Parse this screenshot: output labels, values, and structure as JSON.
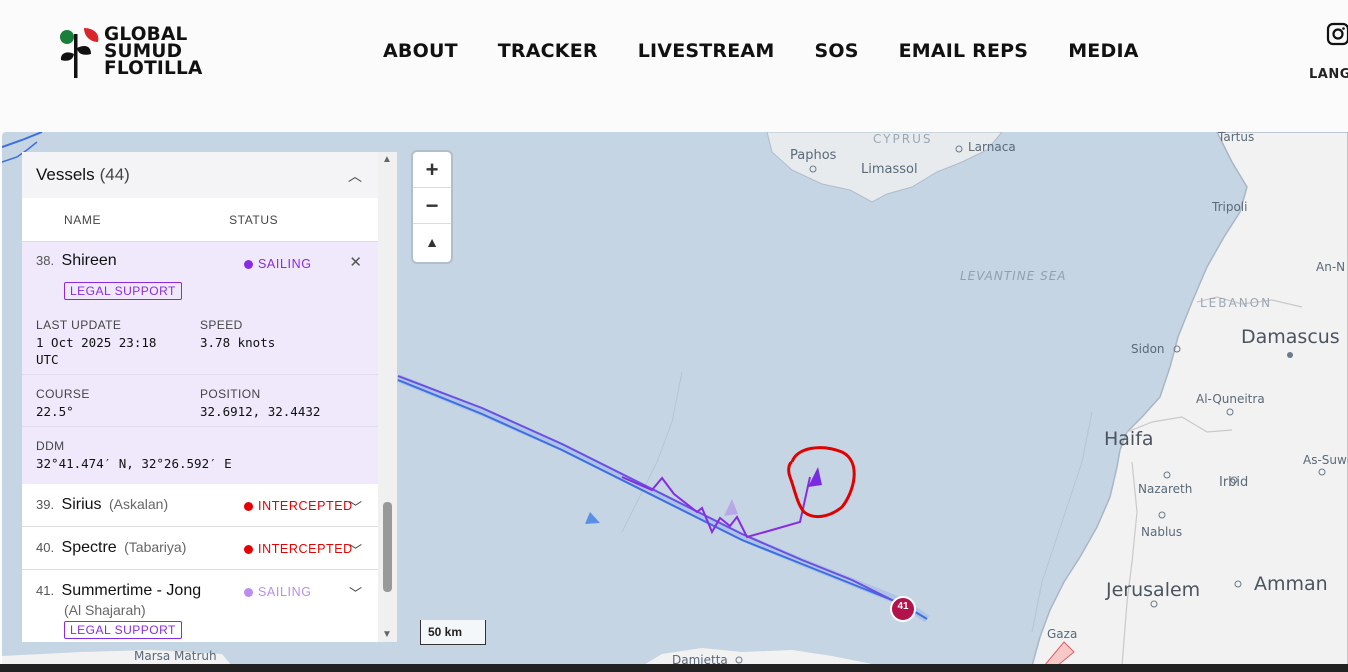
{
  "header": {
    "logo": [
      "GLOBAL",
      "SUMUD",
      "FLOTILLA"
    ],
    "nav": [
      "ABOUT",
      "TRACKER",
      "LIVESTREAM",
      "SOS",
      "EMAIL REPS",
      "MEDIA"
    ],
    "lang": "LANG"
  },
  "map": {
    "places": {
      "cyprus": "CYPRUS",
      "paphos": "Paphos",
      "limassol": "Limassol",
      "larnaca": "Larnaca",
      "tartus": "Tartus",
      "tripoli": "Tripoli",
      "an_n": "An-N",
      "lebanon": "LEBANON",
      "damascus": "Damascus",
      "sidon": "Sidon",
      "levantine": "LEVANTINE SEA",
      "al_quneitra": "Al-Quneitra",
      "haifa": "Haifa",
      "as_sweida": "As-Suweid",
      "nazareth": "Nazareth",
      "irbid": "Irbid",
      "nablus": "Nablus",
      "jerusalem": "Jerusalem",
      "amman": "Amman",
      "gaza": "Gaza",
      "damietta": "Damietta",
      "marsa": "Marsa Matruh"
    },
    "marker_label": "41",
    "scale_label": "50 km",
    "zoom": {
      "in": "+",
      "out": "−",
      "compass": "▲"
    }
  },
  "panel": {
    "title": "Vessels",
    "count": "(44)",
    "col_name": "NAME",
    "col_status": "STATUS",
    "selected": {
      "num": "38.",
      "name": "Shireen",
      "status": "SAILING",
      "badge": "LEGAL SUPPORT",
      "last_update_label": "LAST UPDATE",
      "last_update": "1 Oct 2025 23:18 UTC",
      "speed_label": "SPEED",
      "speed": "3.78 knots",
      "course_label": "COURSE",
      "course": "22.5°",
      "position_label": "POSITION",
      "position": "32.6912, 32.4432",
      "ddm_label": "DDM",
      "ddm": "32°41.474′ N, 32°26.592′ E"
    },
    "rows": [
      {
        "num": "39.",
        "name": "Sirius",
        "alias": "(Askalan)",
        "status": "INTERCEPTED"
      },
      {
        "num": "40.",
        "name": "Spectre",
        "alias": "(Tabariya)",
        "status": "INTERCEPTED"
      },
      {
        "num": "41.",
        "name": "Summertime - Jong",
        "alias": "(Al Shajarah)",
        "status": "SAILING",
        "badge": "LEGAL SUPPORT"
      }
    ]
  },
  "colors": {
    "sailing": "#8a2be2",
    "sailing_light": "#b98ef0",
    "intercepted": "#e60000",
    "track": "#3b6fe0",
    "annotation": "#e00000",
    "marker": "#b3124a"
  }
}
